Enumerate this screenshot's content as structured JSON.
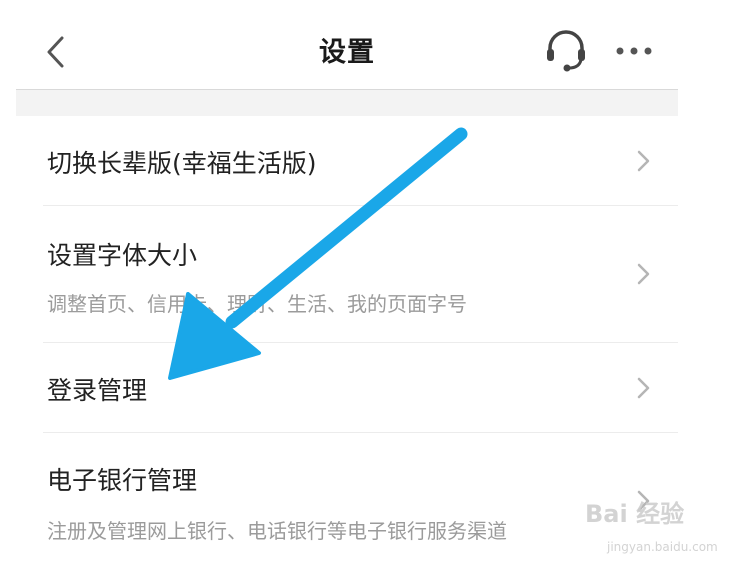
{
  "header": {
    "title": "设置",
    "back_icon": "chevron-left-icon",
    "support_icon": "headset-icon",
    "more_icon": "more-dots-icon"
  },
  "settings": [
    {
      "label": "切换长辈版(幸福生活版)",
      "sub": ""
    },
    {
      "label": "设置字体大小",
      "sub": "调整首页、信用卡、理财、生活、我的页面字号"
    },
    {
      "label": "登录管理",
      "sub": ""
    },
    {
      "label": "电子银行管理",
      "sub": "注册及管理网上银行、电话银行等电子银行服务渠道"
    }
  ],
  "overlay": {
    "arrow_color": "#1aa7e8",
    "watermark_logo": "Bai 经验",
    "watermark_url": "jingyan.baidu.com"
  },
  "colors": {
    "text_primary": "#222222",
    "text_secondary": "#9b9b9b",
    "chevron": "#b5b5b5",
    "gap_background": "#f3f3f3"
  }
}
